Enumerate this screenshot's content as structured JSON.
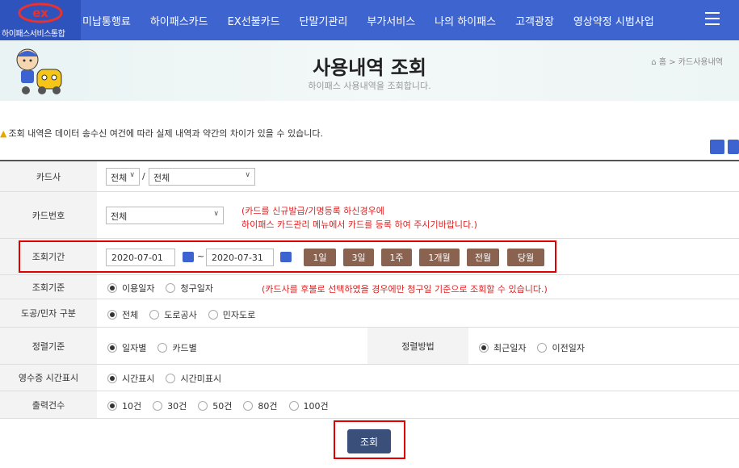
{
  "logo": {
    "sub": "하이패스서비스통합"
  },
  "nav": [
    "미납통행료",
    "하이패스카드",
    "EX선불카드",
    "단말기관리",
    "부가서비스",
    "나의 하이패스",
    "고객광장",
    "영상약정 시범사업"
  ],
  "header": {
    "title": "사용내역 조회",
    "subtitle": "하이패스 사용내역을 조회합니다.",
    "breadcrumb_home": "홈",
    "breadcrumb_current": "카드사용내역"
  },
  "notice": "조회 내역은 데이터 송수신 여건에 따라 실제 내역과 약간의 차이가 있을 수 있습니다.",
  "form": {
    "card_company_label": "카드사",
    "card_company_all": "전체",
    "card_company_sep": "/",
    "card_company_detail": "전체",
    "card_number_label": "카드번호",
    "card_number_value": "전체",
    "card_number_note1": "(카드를 신규발급/기명등록 하신경우에",
    "card_number_note2": "하이패스 카드관리 메뉴에서 카드를 등록 하여 주시기바랍니다.)",
    "period_label": "조회기간",
    "date_from": "2020-07-01",
    "date_tilde": "~",
    "date_to": "2020-07-31",
    "period_buttons": [
      "1일",
      "3일",
      "1주",
      "1개월",
      "전월",
      "당월"
    ],
    "basis_label": "조회기준",
    "basis_options": [
      "이용일자",
      "청구일자"
    ],
    "basis_note": "(카드사를 후불로 선택하였을 경우에만 청구일 기준으로 조회할 수 있습니다.)",
    "road_label": "도공/민자 구분",
    "road_options": [
      "전체",
      "도로공사",
      "민자도로"
    ],
    "sort_label": "정렬기준",
    "sort_options": [
      "일자별",
      "카드별"
    ],
    "sort_method_label": "정렬방법",
    "sort_method_options": [
      "최근일자",
      "이전일자"
    ],
    "receipt_label": "영수증 시간표시",
    "receipt_options": [
      "시간표시",
      "시간미표시"
    ],
    "count_label": "출력건수",
    "count_options": [
      "10건",
      "30건",
      "50건",
      "80건",
      "100건"
    ],
    "search_button": "조회"
  },
  "colors": {
    "nav_bg": "#3e64cf",
    "period_btn": "#8a6250",
    "highlight": "#e00000",
    "search_btn": "#3a4f7a"
  }
}
